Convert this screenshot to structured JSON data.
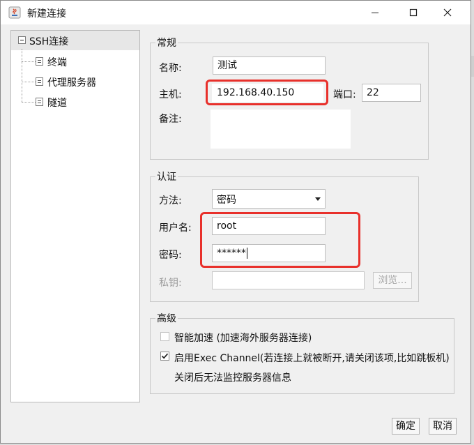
{
  "window": {
    "title": "新建连接"
  },
  "tree": {
    "root": "SSH连接",
    "items": [
      "终端",
      "代理服务器",
      "隧道"
    ]
  },
  "general": {
    "title": "常规",
    "name_label": "名称:",
    "name_value": "测试",
    "host_label": "主机:",
    "host_value": "192.168.40.150",
    "port_label": "端口:",
    "port_value": "22",
    "note_label": "备注:",
    "note_value": ""
  },
  "auth": {
    "title": "认证",
    "method_label": "方法:",
    "method_value": "密码",
    "user_label": "用户名:",
    "user_value": "root",
    "pass_label": "密码:",
    "pass_value": "******",
    "key_label": "私钥:",
    "key_value": "",
    "browse_label": "浏览..."
  },
  "advanced": {
    "title": "高级",
    "opt1_label": "智能加速 (加速海外服务器连接)",
    "opt1_checked": false,
    "opt2_label": "启用Exec Channel(若连接上就被断开,请关闭该项,比如跳板机)",
    "opt2_checked": true,
    "opt2_note": "关闭后无法监控服务器信息"
  },
  "footer": {
    "ok_label": "确定",
    "cancel_label": "取消"
  },
  "colors": {
    "highlight": "#e8302b",
    "selection": "#e7e7e7"
  }
}
